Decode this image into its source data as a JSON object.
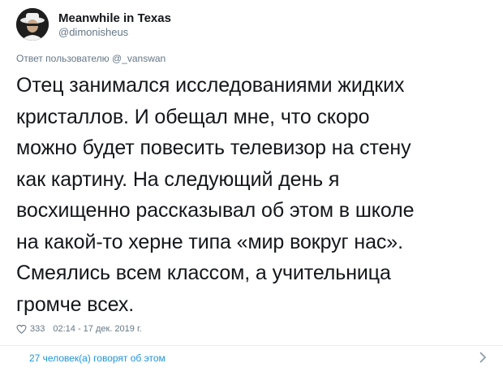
{
  "author": {
    "display_name": "Meanwhile in Texas",
    "handle": "@dimonisheus"
  },
  "reply_context": "Ответ пользователю @_vanswan",
  "tweet": {
    "lines": [
      "Отец занимался исследованиями жидких",
      "кристаллов. И обещал мне, что скоро",
      "можно будет повесить телевизор на стену",
      "как картину. На следующий день я",
      "восхищенно рассказывал об этом в школе",
      "на какой-то херне типа «мир вокруг нас».",
      "Смеялись всем классом, а учительница",
      "громче всех."
    ]
  },
  "meta": {
    "like_count": "333",
    "timestamp": "02:14 - 17 дек. 2019 г."
  },
  "conversation": {
    "label": "27 человек(а) говорят об этом"
  },
  "icons": {
    "like": "heart-icon",
    "chevron": "chevron-right-icon"
  },
  "colors": {
    "text": "#14171a",
    "secondary": "#657786",
    "link": "#1b95e0",
    "divider": "#e6ecf0"
  }
}
